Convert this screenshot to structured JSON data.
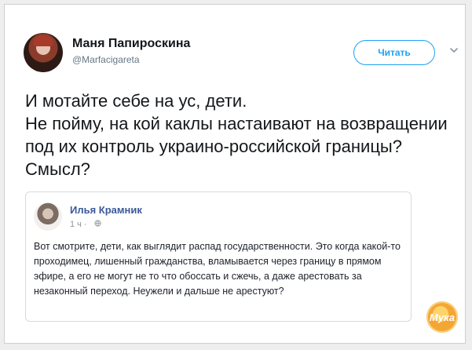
{
  "tweet": {
    "author_name": "Маня Папироскина",
    "author_handle": "@Marfacigareta",
    "follow_label": "Читать",
    "text": "И мотайте себе на ус, дети.\nНе пойму, на кой каклы настаивают на возвращении под их контроль украино-российской границы? Смысл?"
  },
  "quoted_post": {
    "author_name": "Илья Крамник",
    "time": "1 ч",
    "separator": "·",
    "privacy_icon": "globe-icon",
    "text": "Вот смотрите, дети, как выглядит распад государственности. Это когда какой-то проходимец, лишенный гражданства, вламывается через границу в прямом эфире, а его не могут не то что обоссать и сжечь, а даже арестовать за незаконный переход. Неужели и дальше не арестуют?"
  },
  "watermark": {
    "text": "Мука"
  },
  "icons": {
    "caret": "chevron-down-icon"
  },
  "colors": {
    "accent": "#1da1f2",
    "facebook_name": "#3b5998"
  }
}
